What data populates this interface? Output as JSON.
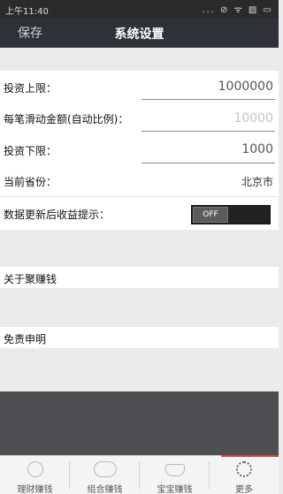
{
  "status_bar": {
    "time": "上午11:40",
    "icons": "... ⊘ ᯤ ▨ ▭"
  },
  "header": {
    "save_label": "保存",
    "title": "系统设置"
  },
  "settings": {
    "invest_max": {
      "label": "投资上限：",
      "value": "1000000"
    },
    "per_slide_amount": {
      "label": "每笔滑动金额(自动比例)：",
      "placeholder": "10000"
    },
    "invest_min": {
      "label": "投资下限：",
      "value": "1000"
    },
    "province": {
      "label": "当前省份：",
      "value": "北京市"
    },
    "update_notify": {
      "label": "数据更新后收益提示：",
      "toggle_state": "OFF"
    }
  },
  "links": {
    "about": "关于聚赚钱",
    "disclaimer": "免责申明"
  },
  "tabs": [
    {
      "label": "理财赚钱",
      "icon": "coin-icon"
    },
    {
      "label": "组合赚钱",
      "icon": "double-coin-icon"
    },
    {
      "label": "宝宝赚钱",
      "icon": "ingot-icon"
    },
    {
      "label": "更多",
      "icon": "gear-icon"
    }
  ],
  "colors": {
    "header_bg": "#2e3238",
    "active_tab": "#e13a3a"
  }
}
